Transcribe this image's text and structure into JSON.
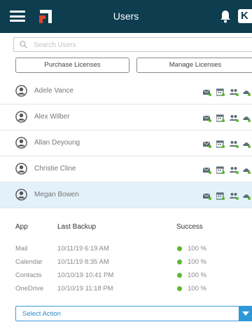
{
  "header": {
    "title": "Users",
    "badge_text": "K"
  },
  "search": {
    "placeholder": "Search Users"
  },
  "actions": {
    "purchase_label": "Purchase Licenses",
    "manage_label": "Manage Licenses"
  },
  "users": [
    {
      "name": "Adele Vance"
    },
    {
      "name": "Alex Wilber"
    },
    {
      "name": "Allan Deyoung"
    },
    {
      "name": "Christie Cline"
    },
    {
      "name": "Megan Bowen",
      "selected": true
    }
  ],
  "row_icons": [
    "mail-icon",
    "calendar-icon",
    "contacts-icon",
    "onedrive-icon"
  ],
  "details": {
    "headers": {
      "app": "App",
      "last_backup": "Last Backup",
      "success": "Success"
    },
    "rows": [
      {
        "app": "Mail",
        "last_backup": "10/11/19 6:19 AM",
        "success": "100 %"
      },
      {
        "app": "Calendar",
        "last_backup": "10/11/19 8:35 AM",
        "success": "100 %"
      },
      {
        "app": "Contacts",
        "last_backup": "10/10/19 10:41 PM",
        "success": "100 %"
      },
      {
        "app": "OneDrive",
        "last_backup": "10/10/19 11:18 PM",
        "success": "100 %"
      }
    ]
  },
  "select_action": {
    "label": "Select Action"
  },
  "colors": {
    "header_bg": "#0d3d4f",
    "accent": "#e0452b",
    "selected_row": "#e3f1fa",
    "success_green": "#5cb82f",
    "select_blue": "#2e98d6"
  }
}
